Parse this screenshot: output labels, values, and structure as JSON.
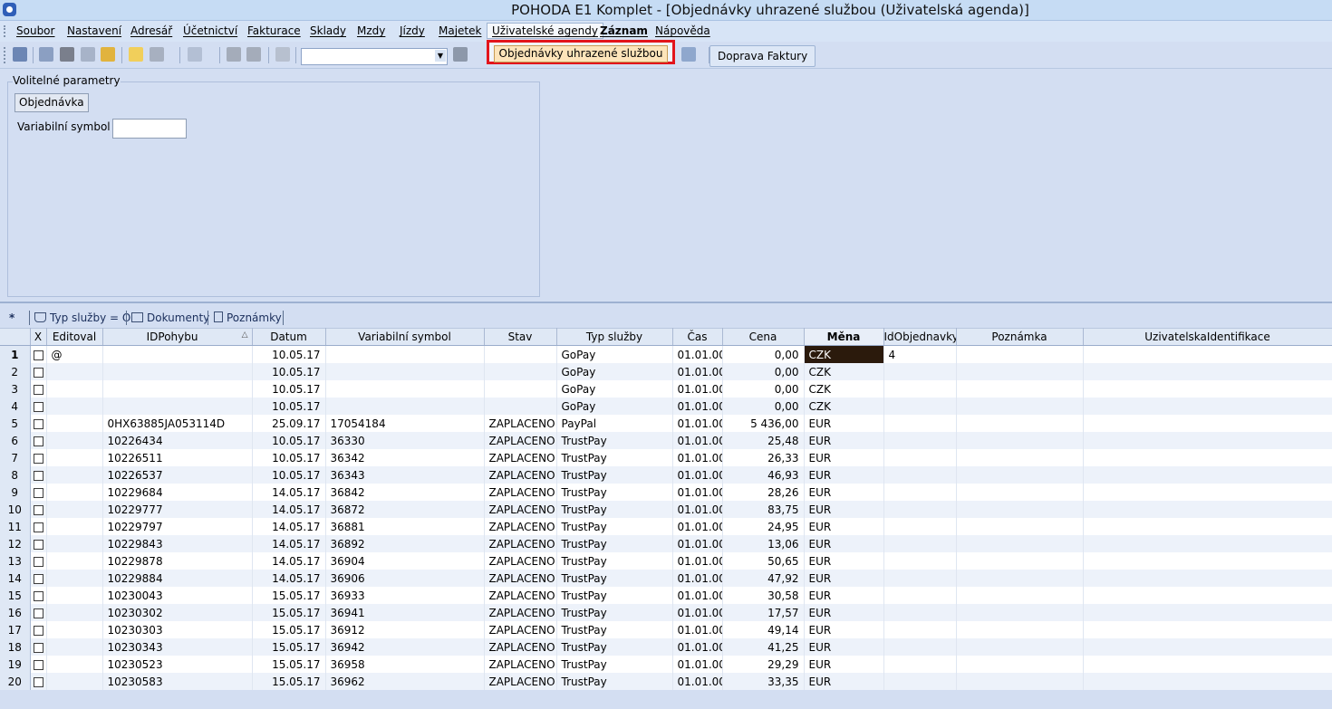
{
  "window": {
    "title": "POHODA E1 Komplet - [Objednávky uhrazené službou (Uživatelská agenda)]"
  },
  "menu": {
    "items": [
      "Soubor",
      "Nastavení",
      "Adresář",
      "Účetnictví",
      "Fakturace",
      "Sklady",
      "Mzdy",
      "Jízdy",
      "Majetek",
      "Uživatelské agendy",
      "Záznam",
      "Nápověda"
    ],
    "active": "Uživatelské agendy"
  },
  "dropdown": {
    "item": "Objednávky uhrazené službou"
  },
  "toolbar": {
    "doprava_label": "Doprava Faktury"
  },
  "params": {
    "legend": "Volitelné parametry",
    "order_button": "Objednávka",
    "vs_label": "Variabilní symbol",
    "vs_value": ""
  },
  "tabs": {
    "star": "*",
    "filter": "Typ služby = O",
    "documents": "Dokumenty",
    "notes": "Poznámky"
  },
  "grid": {
    "columns": [
      "",
      "X",
      "Editoval",
      "IDPohybu",
      "Datum",
      "Variabilní symbol",
      "Stav",
      "Typ služby",
      "Čas",
      "Cena",
      "Měna",
      "IdObjednavky",
      "Poznámka",
      "UzivatelskaIdentifikace"
    ],
    "rows": [
      [
        "1",
        "@",
        "",
        "10.05.17",
        "",
        "",
        "GoPay",
        "01.01.00",
        "0,00",
        "CZK",
        "4",
        "",
        ""
      ],
      [
        "2",
        "",
        "",
        "10.05.17",
        "",
        "",
        "GoPay",
        "01.01.00",
        "0,00",
        "CZK",
        "",
        "",
        ""
      ],
      [
        "3",
        "",
        "",
        "10.05.17",
        "",
        "",
        "GoPay",
        "01.01.00",
        "0,00",
        "CZK",
        "",
        "",
        ""
      ],
      [
        "4",
        "",
        "",
        "10.05.17",
        "",
        "",
        "GoPay",
        "01.01.00",
        "0,00",
        "CZK",
        "",
        "",
        ""
      ],
      [
        "5",
        "",
        "0HX63885JA053114D",
        "25.09.17",
        "17054184",
        "ZAPLACENO",
        "PayPal",
        "01.01.00",
        "5 436,00",
        "EUR",
        "",
        "",
        ""
      ],
      [
        "6",
        "",
        "10226434",
        "10.05.17",
        "36330",
        "ZAPLACENO",
        "TrustPay",
        "01.01.00",
        "25,48",
        "EUR",
        "",
        "",
        ""
      ],
      [
        "7",
        "",
        "10226511",
        "10.05.17",
        "36342",
        "ZAPLACENO",
        "TrustPay",
        "01.01.00",
        "26,33",
        "EUR",
        "",
        "",
        ""
      ],
      [
        "8",
        "",
        "10226537",
        "10.05.17",
        "36343",
        "ZAPLACENO",
        "TrustPay",
        "01.01.00",
        "46,93",
        "EUR",
        "",
        "",
        ""
      ],
      [
        "9",
        "",
        "10229684",
        "14.05.17",
        "36842",
        "ZAPLACENO",
        "TrustPay",
        "01.01.00",
        "28,26",
        "EUR",
        "",
        "",
        ""
      ],
      [
        "10",
        "",
        "10229777",
        "14.05.17",
        "36872",
        "ZAPLACENO",
        "TrustPay",
        "01.01.00",
        "83,75",
        "EUR",
        "",
        "",
        ""
      ],
      [
        "11",
        "",
        "10229797",
        "14.05.17",
        "36881",
        "ZAPLACENO",
        "TrustPay",
        "01.01.00",
        "24,95",
        "EUR",
        "",
        "",
        ""
      ],
      [
        "12",
        "",
        "10229843",
        "14.05.17",
        "36892",
        "ZAPLACENO",
        "TrustPay",
        "01.01.00",
        "13,06",
        "EUR",
        "",
        "",
        ""
      ],
      [
        "13",
        "",
        "10229878",
        "14.05.17",
        "36904",
        "ZAPLACENO",
        "TrustPay",
        "01.01.00",
        "50,65",
        "EUR",
        "",
        "",
        ""
      ],
      [
        "14",
        "",
        "10229884",
        "14.05.17",
        "36906",
        "ZAPLACENO",
        "TrustPay",
        "01.01.00",
        "47,92",
        "EUR",
        "",
        "",
        ""
      ],
      [
        "15",
        "",
        "10230043",
        "15.05.17",
        "36933",
        "ZAPLACENO",
        "TrustPay",
        "01.01.00",
        "30,58",
        "EUR",
        "",
        "",
        ""
      ],
      [
        "16",
        "",
        "10230302",
        "15.05.17",
        "36941",
        "ZAPLACENO",
        "TrustPay",
        "01.01.00",
        "17,57",
        "EUR",
        "",
        "",
        ""
      ],
      [
        "17",
        "",
        "10230303",
        "15.05.17",
        "36912",
        "ZAPLACENO",
        "TrustPay",
        "01.01.00",
        "49,14",
        "EUR",
        "",
        "",
        ""
      ],
      [
        "18",
        "",
        "10230343",
        "15.05.17",
        "36942",
        "ZAPLACENO",
        "TrustPay",
        "01.01.00",
        "41,25",
        "EUR",
        "",
        "",
        ""
      ],
      [
        "19",
        "",
        "10230523",
        "15.05.17",
        "36958",
        "ZAPLACENO",
        "TrustPay",
        "01.01.00",
        "29,29",
        "EUR",
        "",
        "",
        ""
      ],
      [
        "20",
        "",
        "10230583",
        "15.05.17",
        "36962",
        "ZAPLACENO",
        "TrustPay",
        "01.01.00",
        "33,35",
        "EUR",
        "",
        "",
        ""
      ]
    ]
  },
  "colors": {
    "highlight_border": "#e3141b",
    "selected_cell": "#2b1a0c",
    "dropdown_item": "#fde4ba"
  }
}
